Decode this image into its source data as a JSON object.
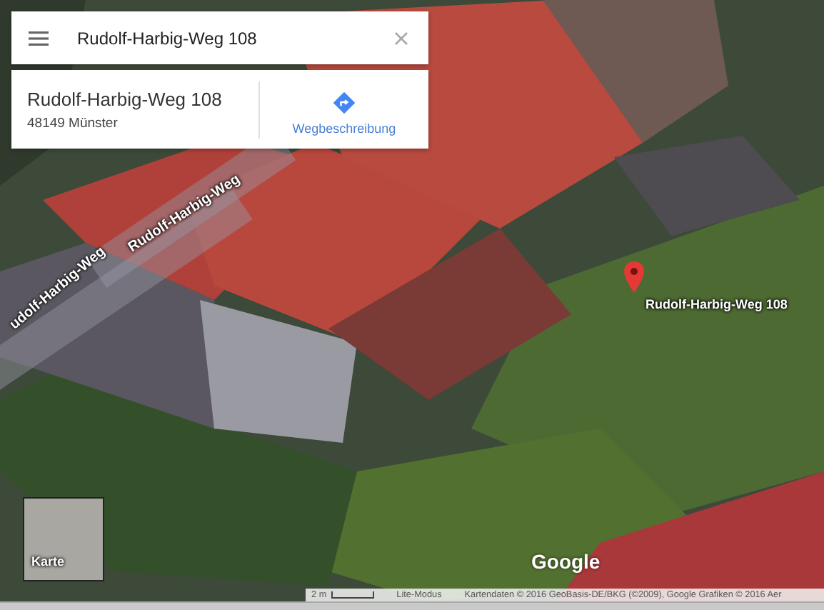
{
  "search": {
    "value": "Rudolf-Harbig-Weg 108"
  },
  "place_card": {
    "title": "Rudolf-Harbig-Weg 108",
    "address": "48149 Münster",
    "directions_label": "Wegbeschreibung"
  },
  "map": {
    "street_labels": [
      "udolf-Harbig-Weg",
      "Rudolf-Harbig-Weg"
    ],
    "marker_label": "Rudolf-Harbig-Weg 108",
    "minimap_label": "Karte",
    "logo": "Google",
    "scale": "2 m",
    "mode_link": "Lite-Modus",
    "attribution": "Kartendaten © 2016 GeoBasis-DE/BKG (©2009), Google Grafiken © 2016 Aer"
  }
}
